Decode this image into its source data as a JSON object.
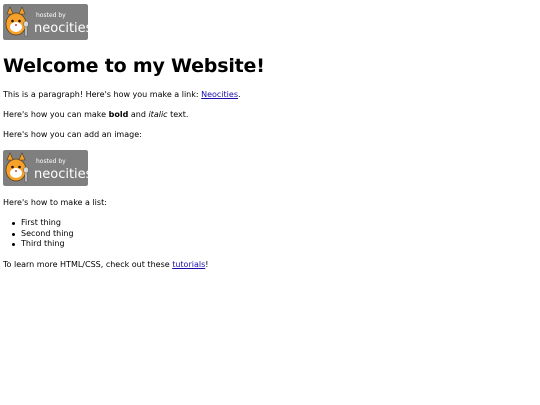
{
  "badge": {
    "line1": "hosted by",
    "line2": "neocities",
    "bg": "#7f7f7f",
    "fg": "#ffffff",
    "cat_orange": "#f5a12b"
  },
  "heading": "Welcome to my Website!",
  "para1": {
    "text": "This is a paragraph! Here's how you make a link: ",
    "link": "Neocities",
    "after": "."
  },
  "para2": {
    "before": "Here's how you can make ",
    "bold": "bold",
    "middle": " and ",
    "italic": "italic",
    "after": " text."
  },
  "para3": "Here's how you can add an image:",
  "para4": "Here's how to make a list:",
  "list": [
    "First thing",
    "Second thing",
    "Third thing"
  ],
  "para5": {
    "text": "To learn more HTML/CSS, check out these ",
    "link": "tutorials",
    "after": "!"
  }
}
